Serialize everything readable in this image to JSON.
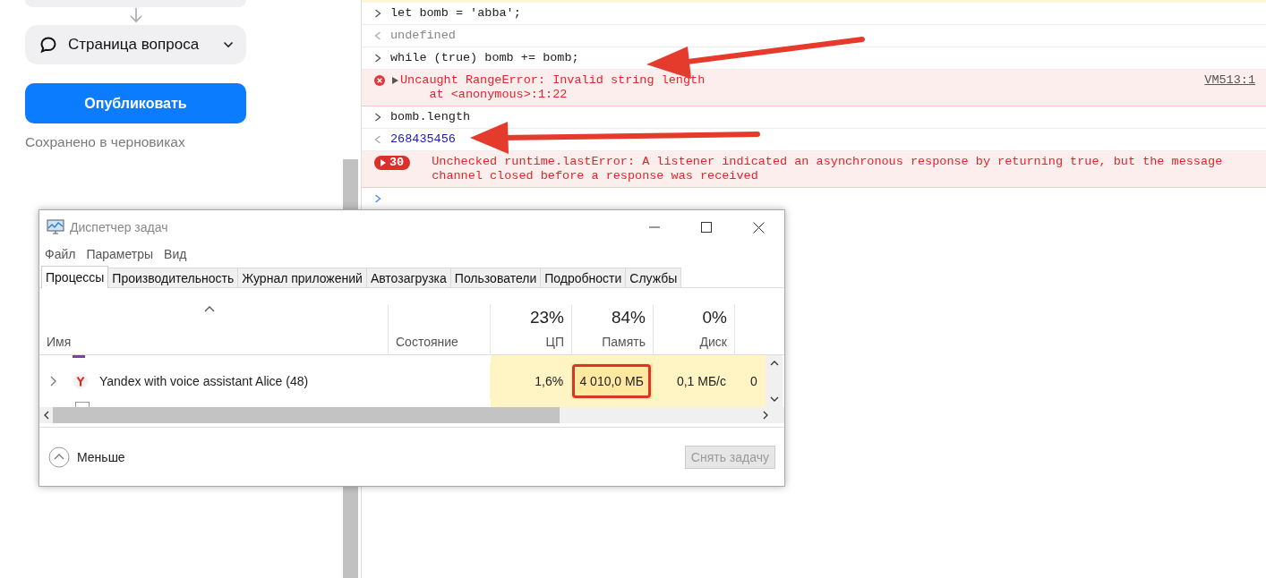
{
  "editor_panel": {
    "dropdown": {
      "label": "Страница вопроса",
      "expanded": false
    },
    "publish_button": "Опубликовать",
    "save_status": "Сохранено в черновиках"
  },
  "console": {
    "entries": [
      {
        "kind": "input",
        "text": "let bomb = 'abba';"
      },
      {
        "kind": "undefined_result",
        "text": "undefined"
      },
      {
        "kind": "input",
        "text": "while (true) bomb += bomb;"
      },
      {
        "kind": "error",
        "expanded": false,
        "lines": [
          "Uncaught RangeError: Invalid string length",
          "    at <anonymous>:1:22"
        ],
        "source": "VM513:1"
      },
      {
        "kind": "input",
        "text": "bomb.length"
      },
      {
        "kind": "number_result",
        "text": "268435456"
      },
      {
        "kind": "error_group",
        "count": "30",
        "text": "Unchecked runtime.lastError: A listener indicated an asynchronous response by returning true, but the message channel closed before a response was received"
      }
    ]
  },
  "task_manager": {
    "title": "Диспетчер задач",
    "menu": [
      "Файл",
      "Параметры",
      "Вид"
    ],
    "tabs": [
      {
        "label": "Процессы",
        "selected": true
      },
      {
        "label": "Производительность",
        "selected": false
      },
      {
        "label": "Журнал приложений",
        "selected": false
      },
      {
        "label": "Автозагрузка",
        "selected": false
      },
      {
        "label": "Пользователи",
        "selected": false
      },
      {
        "label": "Подробности",
        "selected": false
      },
      {
        "label": "Службы",
        "selected": false
      }
    ],
    "columns": [
      {
        "label": "Имя"
      },
      {
        "label": "Состояние"
      },
      {
        "label": "ЦП",
        "total": "23%"
      },
      {
        "label": "Память",
        "total": "84%"
      },
      {
        "label": "Диск",
        "total": "0%"
      }
    ],
    "rows": [
      {
        "name": "Yandex with voice assistant Alice (48)",
        "expanded": false,
        "cpu": "1,6%",
        "memory": "4 010,0 МБ",
        "memory_highlighted": true,
        "disk": "0,1 МБ/с",
        "network": "0"
      }
    ],
    "less_button": "Меньше",
    "end_task_button": {
      "label": "Снять задачу",
      "disabled": true
    }
  }
}
